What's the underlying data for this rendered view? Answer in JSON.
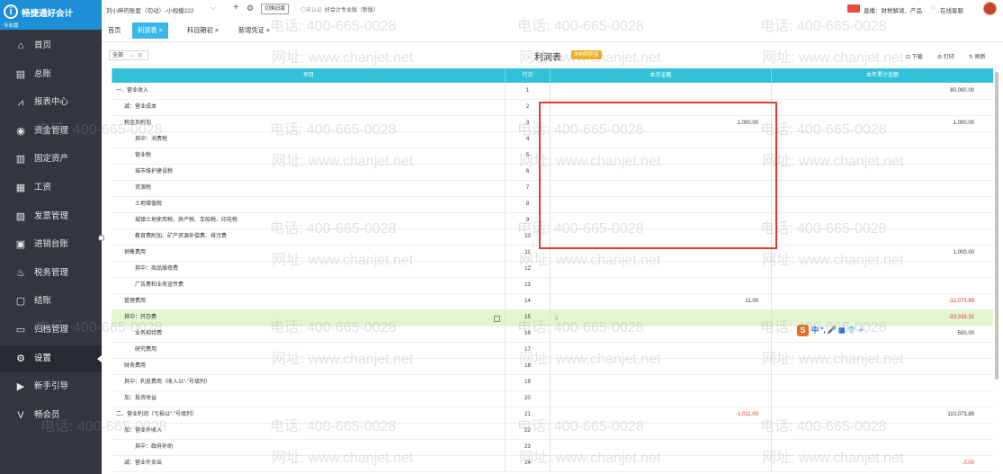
{
  "app": {
    "name": "畅捷通好会计",
    "edition": "专业版"
  },
  "sidebar": {
    "items": [
      {
        "icon": "⌂",
        "icon_name": "home-icon",
        "label": "首页"
      },
      {
        "icon": "▤",
        "icon_name": "ledger-icon",
        "label": "总账"
      },
      {
        "icon": "⩘",
        "icon_name": "chart-icon",
        "label": "报表中心"
      },
      {
        "icon": "◉",
        "icon_name": "fund-icon",
        "label": "资金管理"
      },
      {
        "icon": "▥",
        "icon_name": "asset-icon",
        "label": "固定资产"
      },
      {
        "icon": "▦",
        "icon_name": "salary-icon",
        "label": "工资"
      },
      {
        "icon": "▧",
        "icon_name": "invoice-icon",
        "label": "发票管理"
      },
      {
        "icon": "▣",
        "icon_name": "inventory-icon",
        "label": "进销台账"
      },
      {
        "icon": "♨",
        "icon_name": "tax-icon",
        "label": "税务管理"
      },
      {
        "icon": "▢",
        "icon_name": "close-books-icon",
        "label": "结账"
      },
      {
        "icon": "▭",
        "icon_name": "archive-icon",
        "label": "归档管理"
      },
      {
        "icon": "⚙",
        "icon_name": "settings-icon",
        "label": "设置"
      },
      {
        "icon": "▶",
        "icon_name": "guide-icon",
        "label": "新手引导"
      },
      {
        "icon": "V",
        "icon_name": "vip-icon",
        "label": "畅会员"
      }
    ]
  },
  "header": {
    "account": "刘小畔的账套（勿动）-小规模222",
    "switch_label": "切换旧版",
    "unverified": "◎未认证",
    "consult": "好会计专业版（新版）",
    "live": "直播：财税解读、产品",
    "online_service": "在线客服"
  },
  "tabs": [
    {
      "label": "首页",
      "closable": false,
      "active": false
    },
    {
      "label": "利润表",
      "closable": true,
      "active": true
    },
    {
      "label": "科目期初",
      "closable": true,
      "active": false
    },
    {
      "label": "新增凭证",
      "closable": true,
      "active": false
    }
  ],
  "toolbar": {
    "filter_value": "全部",
    "report_title": "利润表",
    "report_badge": "未结转损益",
    "actions": [
      "下载",
      "打印",
      "刷新"
    ]
  },
  "table": {
    "headers": [
      "项目",
      "行次",
      "本月金额",
      "本年累计金额"
    ],
    "rows": [
      {
        "item": "一、营业收入",
        "no": "1",
        "month": "",
        "year": "80,000.00"
      },
      {
        "item": "减：营业成本",
        "no": "2",
        "month": "",
        "year": ""
      },
      {
        "item": "税金及附加",
        "no": "3",
        "month": "1,000.00",
        "year": "1,000.00"
      },
      {
        "item": "其中：消费税",
        "no": "4",
        "month": "",
        "year": ""
      },
      {
        "item": "营业税",
        "no": "5",
        "month": "",
        "year": ""
      },
      {
        "item": "城市维护建设税",
        "no": "6",
        "month": "",
        "year": ""
      },
      {
        "item": "资源税",
        "no": "7",
        "month": "",
        "year": ""
      },
      {
        "item": "土地增值税",
        "no": "8",
        "month": "",
        "year": ""
      },
      {
        "item": "城镇土地使用税、房产税、车船税、印花税",
        "no": "9",
        "month": "",
        "year": ""
      },
      {
        "item": "教育费附加、矿产资源补偿费、排污费",
        "no": "10",
        "month": "",
        "year": ""
      },
      {
        "item": "销售费用",
        "no": "11",
        "month": "",
        "year": "1,000.00"
      },
      {
        "item": "其中：商品维修费",
        "no": "12",
        "month": "",
        "year": ""
      },
      {
        "item": "广告费和业务宣传费",
        "no": "13",
        "month": "",
        "year": ""
      },
      {
        "item": "管理费用",
        "no": "14",
        "month": "11.00",
        "year": "-32,073.89"
      },
      {
        "item": "其中：开办费",
        "no": "15",
        "month": "",
        "year": "-33,333.32"
      },
      {
        "item": "业务招待费",
        "no": "16",
        "month": "",
        "year": "500.00"
      },
      {
        "item": "研究费用",
        "no": "17",
        "month": "",
        "year": ""
      },
      {
        "item": "财务费用",
        "no": "18",
        "month": "",
        "year": ""
      },
      {
        "item": "其中：利息费用（收入以“-”号填列）",
        "no": "19",
        "month": "",
        "year": ""
      },
      {
        "item": "加：投资收益",
        "no": "20",
        "month": "",
        "year": ""
      },
      {
        "item": "二、营业利润（亏损以“-”号填列）",
        "no": "21",
        "month": "-1,011.00",
        "year": "110,073.89"
      },
      {
        "item": "加：营业外收入",
        "no": "22",
        "month": "",
        "year": ""
      },
      {
        "item": "其中：政府补助",
        "no": "23",
        "month": "",
        "year": ""
      },
      {
        "item": "减：营业外支出",
        "no": "24",
        "month": "",
        "year": "-3.00"
      }
    ]
  },
  "watermark": {
    "phone": "电话: 400-665-0028",
    "site": "网址: www.chanjet.net"
  },
  "ime": {
    "label": "中"
  },
  "colors": {
    "sidebar": "#32373f",
    "logo": "#1d8fd6",
    "header_row": "#33c1d9",
    "negative": "#e1322b",
    "highlight": "#e23b2e"
  }
}
